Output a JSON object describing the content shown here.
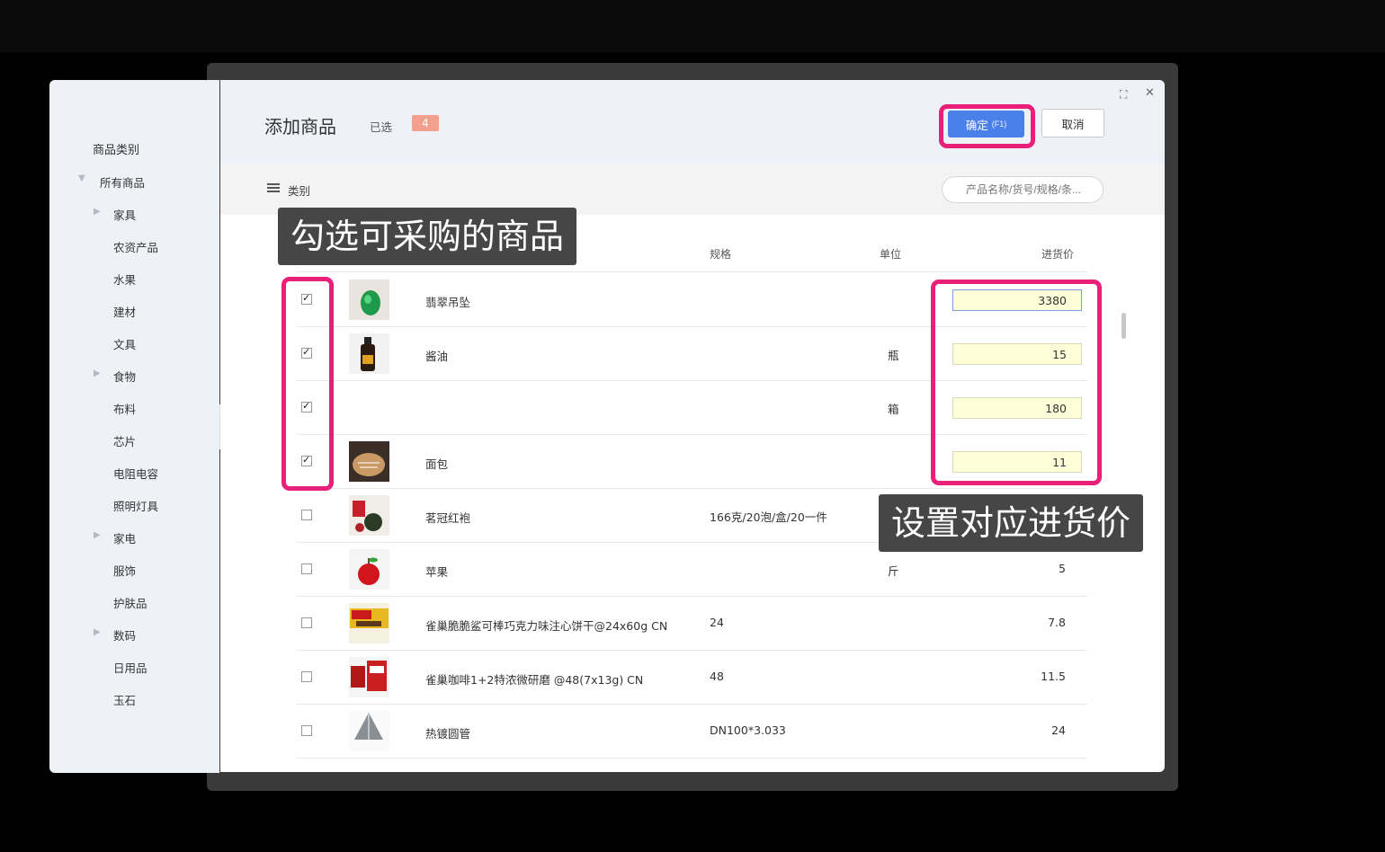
{
  "dialog": {
    "title": "添加商品",
    "selected_label": "已选",
    "selected_count": "4",
    "confirm_label": "确定",
    "confirm_hotkey": "(F1)",
    "cancel_label": "取消",
    "category_label": "类别",
    "search_placeholder": "产品名称/货号/规格/条..."
  },
  "sidebar": {
    "title": "商品类别",
    "root": "所有商品",
    "items": [
      {
        "label": "家具",
        "expandable": true
      },
      {
        "label": "农资产品",
        "expandable": false
      },
      {
        "label": "水果",
        "expandable": false
      },
      {
        "label": "建材",
        "expandable": false
      },
      {
        "label": "文具",
        "expandable": false
      },
      {
        "label": "食物",
        "expandable": true
      },
      {
        "label": "布料",
        "expandable": false
      },
      {
        "label": "芯片",
        "expandable": false
      },
      {
        "label": "电阻电容",
        "expandable": false
      },
      {
        "label": "照明灯具",
        "expandable": false
      },
      {
        "label": "家电",
        "expandable": true
      },
      {
        "label": "服饰",
        "expandable": false
      },
      {
        "label": "护肤品",
        "expandable": false
      },
      {
        "label": "数码",
        "expandable": true
      },
      {
        "label": "日用品",
        "expandable": false
      },
      {
        "label": "玉石",
        "expandable": false
      }
    ]
  },
  "table": {
    "columns": {
      "spec": "规格",
      "unit": "单位",
      "price": "进货价"
    },
    "rows": [
      {
        "name": "翡翠吊坠",
        "spec": "",
        "unit": "",
        "price": "3380",
        "checked": true,
        "editable": true
      },
      {
        "name": "酱油",
        "spec": "",
        "unit": "瓶",
        "price": "15",
        "checked": true,
        "editable": true
      },
      {
        "name": "",
        "spec": "",
        "unit": "箱",
        "price": "180",
        "checked": true,
        "editable": true
      },
      {
        "name": "面包",
        "spec": "",
        "unit": "",
        "price": "11",
        "checked": true,
        "editable": true
      },
      {
        "name": "茗冠红袍",
        "spec": "166克/20泡/盒/20一件",
        "unit": "",
        "price": "",
        "checked": false,
        "editable": false
      },
      {
        "name": "苹果",
        "spec": "",
        "unit": "斤",
        "price": "5",
        "checked": false,
        "editable": false
      },
      {
        "name": "雀巢脆脆鲨可棒巧克力味注心饼干@24x60g CN",
        "spec": "24",
        "unit": "",
        "price": "7.8",
        "checked": false,
        "editable": false
      },
      {
        "name": "雀巢咖啡1+2特浓微研磨 @48(7x13g) CN",
        "spec": "48",
        "unit": "",
        "price": "11.5",
        "checked": false,
        "editable": false
      },
      {
        "name": "热镀圆管",
        "spec": "DN100*3.033",
        "unit": "",
        "price": "24",
        "checked": false,
        "editable": false
      }
    ]
  },
  "annotations": {
    "select_goods": "勾选可采购的商品",
    "set_price": "设置对应进货价"
  },
  "colors": {
    "accent": "#4a80ea",
    "highlight": "#e8207a",
    "badge": "#f4a08e"
  }
}
